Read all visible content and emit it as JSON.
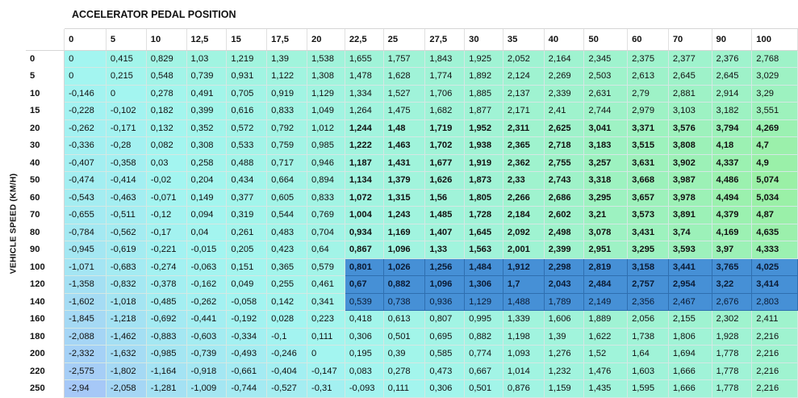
{
  "x_axis_title": "ACCELERATOR PEDAL POSITION",
  "y_axis_title": "VEHICLE SPEED (KM/H)",
  "columns": [
    "0",
    "5",
    "10",
    "12,5",
    "15",
    "17,5",
    "20",
    "22,5",
    "25",
    "27,5",
    "30",
    "35",
    "40",
    "50",
    "60",
    "70",
    "90",
    "100"
  ],
  "rows": [
    {
      "speed": "0",
      "values": [
        "0",
        "0,415",
        "0,829",
        "1,03",
        "1,219",
        "1,39",
        "1,538",
        "1,655",
        "1,757",
        "1,843",
        "1,925",
        "2,052",
        "2,164",
        "2,345",
        "2,375",
        "2,377",
        "2,376",
        "2,768"
      ]
    },
    {
      "speed": "5",
      "values": [
        "0",
        "0,215",
        "0,548",
        "0,739",
        "0,931",
        "1,122",
        "1,308",
        "1,478",
        "1,628",
        "1,774",
        "1,892",
        "2,124",
        "2,269",
        "2,503",
        "2,613",
        "2,645",
        "2,645",
        "3,029"
      ]
    },
    {
      "speed": "10",
      "values": [
        "-0,146",
        "0",
        "0,278",
        "0,491",
        "0,705",
        "0,919",
        "1,129",
        "1,334",
        "1,527",
        "1,706",
        "1,885",
        "2,137",
        "2,339",
        "2,631",
        "2,79",
        "2,881",
        "2,914",
        "3,29"
      ]
    },
    {
      "speed": "15",
      "values": [
        "-0,228",
        "-0,102",
        "0,182",
        "0,399",
        "0,616",
        "0,833",
        "1,049",
        "1,264",
        "1,475",
        "1,682",
        "1,877",
        "2,171",
        "2,41",
        "2,744",
        "2,979",
        "3,103",
        "3,182",
        "3,551"
      ]
    },
    {
      "speed": "20",
      "values": [
        "-0,262",
        "-0,171",
        "0,132",
        "0,352",
        "0,572",
        "0,792",
        "1,012",
        "1,244",
        "1,48",
        "1,719",
        "1,952",
        "2,311",
        "2,625",
        "3,041",
        "3,371",
        "3,576",
        "3,794",
        "4,269"
      ]
    },
    {
      "speed": "30",
      "values": [
        "-0,336",
        "-0,28",
        "0,082",
        "0,308",
        "0,533",
        "0,759",
        "0,985",
        "1,222",
        "1,463",
        "1,702",
        "1,938",
        "2,365",
        "2,718",
        "3,183",
        "3,515",
        "3,808",
        "4,18",
        "4,7"
      ]
    },
    {
      "speed": "40",
      "values": [
        "-0,407",
        "-0,358",
        "0,03",
        "0,258",
        "0,488",
        "0,717",
        "0,946",
        "1,187",
        "1,431",
        "1,677",
        "1,919",
        "2,362",
        "2,755",
        "3,257",
        "3,631",
        "3,902",
        "4,337",
        "4,9"
      ]
    },
    {
      "speed": "50",
      "values": [
        "-0,474",
        "-0,414",
        "-0,02",
        "0,204",
        "0,434",
        "0,664",
        "0,894",
        "1,134",
        "1,379",
        "1,626",
        "1,873",
        "2,33",
        "2,743",
        "3,318",
        "3,668",
        "3,987",
        "4,486",
        "5,074"
      ]
    },
    {
      "speed": "60",
      "values": [
        "-0,543",
        "-0,463",
        "-0,071",
        "0,149",
        "0,377",
        "0,605",
        "0,833",
        "1,072",
        "1,315",
        "1,56",
        "1,805",
        "2,266",
        "2,686",
        "3,295",
        "3,657",
        "3,978",
        "4,494",
        "5,034"
      ]
    },
    {
      "speed": "70",
      "values": [
        "-0,655",
        "-0,511",
        "-0,12",
        "0,094",
        "0,319",
        "0,544",
        "0,769",
        "1,004",
        "1,243",
        "1,485",
        "1,728",
        "2,184",
        "2,602",
        "3,21",
        "3,573",
        "3,891",
        "4,379",
        "4,87"
      ]
    },
    {
      "speed": "80",
      "values": [
        "-0,784",
        "-0,562",
        "-0,17",
        "0,04",
        "0,261",
        "0,483",
        "0,704",
        "0,934",
        "1,169",
        "1,407",
        "1,645",
        "2,092",
        "2,498",
        "3,078",
        "3,431",
        "3,74",
        "4,169",
        "4,635"
      ]
    },
    {
      "speed": "90",
      "values": [
        "-0,945",
        "-0,619",
        "-0,221",
        "-0,015",
        "0,205",
        "0,423",
        "0,64",
        "0,867",
        "1,096",
        "1,33",
        "1,563",
        "2,001",
        "2,399",
        "2,951",
        "3,295",
        "3,593",
        "3,97",
        "4,333"
      ]
    },
    {
      "speed": "100",
      "values": [
        "-1,071",
        "-0,683",
        "-0,274",
        "-0,063",
        "0,151",
        "0,365",
        "0,579",
        "0,801",
        "1,026",
        "1,256",
        "1,484",
        "1,912",
        "2,298",
        "2,819",
        "3,158",
        "3,441",
        "3,765",
        "4,025"
      ]
    },
    {
      "speed": "120",
      "values": [
        "-1,358",
        "-0,832",
        "-0,378",
        "-0,162",
        "0,049",
        "0,255",
        "0,461",
        "0,67",
        "0,882",
        "1,096",
        "1,306",
        "1,7",
        "2,043",
        "2,484",
        "2,757",
        "2,954",
        "3,22",
        "3,414"
      ]
    },
    {
      "speed": "140",
      "values": [
        "-1,602",
        "-1,018",
        "-0,485",
        "-0,262",
        "-0,058",
        "0,142",
        "0,341",
        "0,539",
        "0,738",
        "0,936",
        "1,129",
        "1,488",
        "1,789",
        "2,149",
        "2,356",
        "2,467",
        "2,676",
        "2,803"
      ]
    },
    {
      "speed": "160",
      "values": [
        "-1,845",
        "-1,218",
        "-0,692",
        "-0,441",
        "-0,192",
        "0,028",
        "0,223",
        "0,418",
        "0,613",
        "0,807",
        "0,995",
        "1,339",
        "1,606",
        "1,889",
        "2,056",
        "2,155",
        "2,302",
        "2,411"
      ]
    },
    {
      "speed": "180",
      "values": [
        "-2,088",
        "-1,462",
        "-0,883",
        "-0,603",
        "-0,334",
        "-0,1",
        "0,111",
        "0,306",
        "0,501",
        "0,695",
        "0,882",
        "1,198",
        "1,39",
        "1,622",
        "1,738",
        "1,806",
        "1,928",
        "2,216"
      ]
    },
    {
      "speed": "200",
      "values": [
        "-2,332",
        "-1,632",
        "-0,985",
        "-0,739",
        "-0,493",
        "-0,246",
        "0",
        "0,195",
        "0,39",
        "0,585",
        "0,774",
        "1,093",
        "1,276",
        "1,52",
        "1,64",
        "1,694",
        "1,778",
        "2,216"
      ]
    },
    {
      "speed": "220",
      "values": [
        "-2,575",
        "-1,802",
        "-1,164",
        "-0,918",
        "-0,661",
        "-0,404",
        "-0,147",
        "0,083",
        "0,278",
        "0,473",
        "0,667",
        "1,014",
        "1,232",
        "1,476",
        "1,603",
        "1,666",
        "1,778",
        "2,216"
      ]
    },
    {
      "speed": "250",
      "values": [
        "-2,94",
        "-2,058",
        "-1,281",
        "-1,009",
        "-0,744",
        "-0,527",
        "-0,31",
        "-0,093",
        "0,111",
        "0,306",
        "0,501",
        "0,876",
        "1,159",
        "1,435",
        "1,595",
        "1,666",
        "1,778",
        "2,216"
      ]
    }
  ],
  "bold_region": {
    "row_start": 4,
    "row_end": 13,
    "col_start": 7,
    "col_end": 17
  },
  "selection": {
    "row_start": 12,
    "row_end": 14,
    "col_start": 7,
    "col_end": 17
  },
  "colors": {
    "heat_low": "#a6c8f7",
    "heat_mid": "#a3f5f0",
    "heat_high": "#9af0a6",
    "selection_fill": "#4690d6",
    "selection_border": "#1f4f87",
    "grid_line": "#d4e8e4",
    "header_bg": "#ffffff"
  }
}
